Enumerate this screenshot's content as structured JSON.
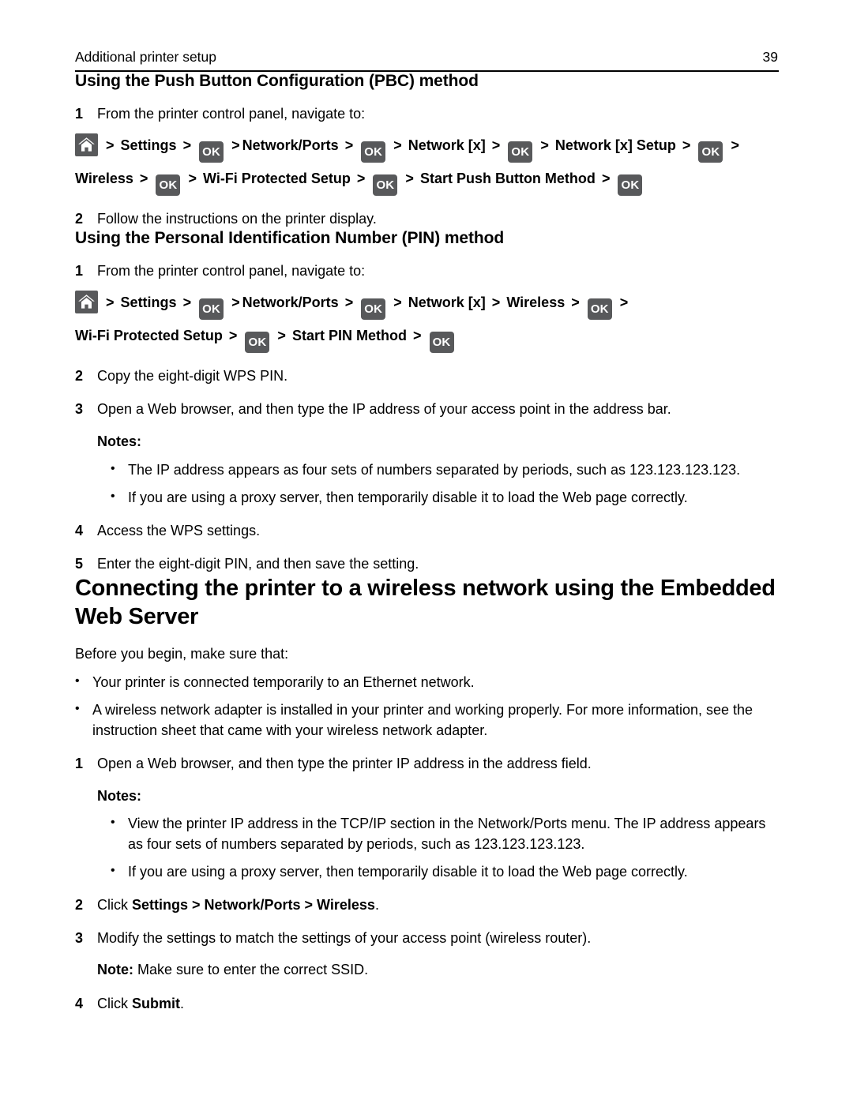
{
  "header": {
    "title": "Additional printer setup",
    "page_number": "39"
  },
  "icons": {
    "home": "home-icon",
    "ok": "OK"
  },
  "pbc_section": {
    "heading": "Using the Push Button Configuration (PBC) method",
    "step1": {
      "number": "1",
      "text": "From the printer control panel, navigate to:"
    },
    "nav_path": {
      "segments": [
        "Settings",
        "Network/Ports",
        "Network [x]",
        "Network [x] Setup",
        "Wireless",
        "Wi‑Fi Protected Setup",
        "Start Push Button Method"
      ],
      "separator": ">"
    },
    "step2": {
      "number": "2",
      "text": "Follow the instructions on the printer display."
    }
  },
  "pin_section": {
    "heading": "Using the Personal Identification Number (PIN) method",
    "step1": {
      "number": "1",
      "text": "From the printer control panel, navigate to:"
    },
    "nav_path": {
      "segments": [
        "Settings",
        "Network/Ports",
        "Network [x]",
        "Wireless",
        "Wi‑Fi Protected Setup",
        "Start PIN Method"
      ],
      "separator": ">"
    },
    "step2": {
      "number": "2",
      "text": "Copy the eight‑digit WPS PIN."
    },
    "step3": {
      "number": "3",
      "text": "Open a Web browser, and then type the IP address of your access point in the address bar."
    },
    "notes_label": "Notes:",
    "notes": [
      "The IP address appears as four sets of numbers separated by periods, such as 123.123.123.123.",
      "If you are using a proxy server, then temporarily disable it to load the Web page correctly."
    ],
    "step4": {
      "number": "4",
      "text": "Access the WPS settings."
    },
    "step5": {
      "number": "5",
      "text": "Enter the eight‑digit PIN, and then save the setting."
    }
  },
  "ews_section": {
    "heading": "Connecting the printer to a wireless network using the Embedded Web Server",
    "intro": "Before you begin, make sure that:",
    "prereqs": [
      "Your printer is connected temporarily to an Ethernet network.",
      "A wireless network adapter is installed in your printer and working properly. For more information, see the instruction sheet that came with your wireless network adapter."
    ],
    "step1": {
      "number": "1",
      "text": "Open a Web browser, and then type the printer IP address in the address field."
    },
    "notes_label": "Notes:",
    "notes": [
      "View the printer IP address in the TCP/IP section in the Network/Ports menu. The IP address appears as four sets of numbers separated by periods, such as 123.123.123.123.",
      "If you are using a proxy server, then temporarily disable it to load the Web page correctly."
    ],
    "step2": {
      "number": "2",
      "prefix": "Click ",
      "bold_path": "Settings > Network/Ports > Wireless",
      "suffix": "."
    },
    "step3": {
      "number": "3",
      "text": "Modify the settings to match the settings of your access point (wireless router)."
    },
    "note_inline": {
      "label": "Note:",
      "text": " Make sure to enter the correct SSID."
    },
    "step4": {
      "number": "4",
      "prefix": "Click ",
      "bold_word": "Submit",
      "suffix": "."
    }
  }
}
